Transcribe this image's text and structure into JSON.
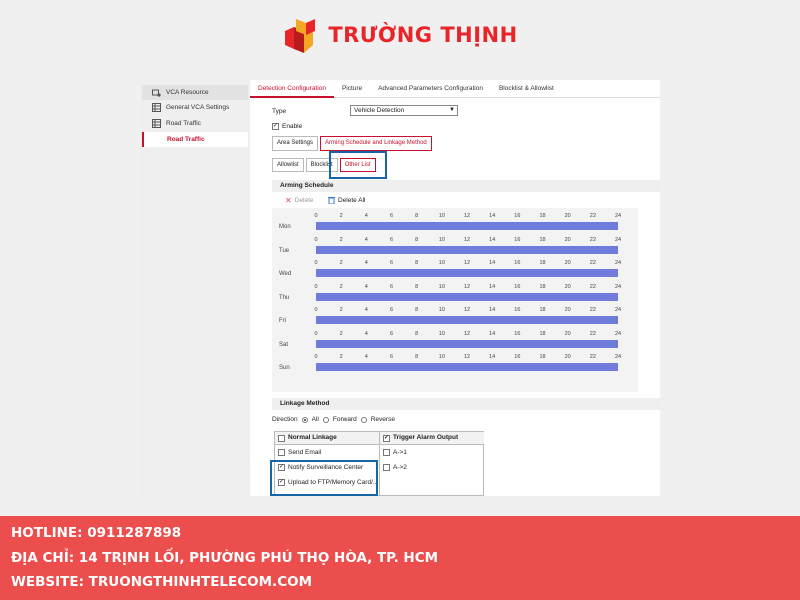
{
  "brand": {
    "name": "TRƯỜNG THỊNH"
  },
  "sidebar": {
    "items": [
      {
        "label": "VCA Resource",
        "icon": "camera-gear-icon"
      },
      {
        "label": "General VCA Settings",
        "icon": "grid-settings-icon"
      },
      {
        "label": "Road Traffic",
        "icon": "grid-settings-icon"
      },
      {
        "label": "Road Traffic",
        "icon": ""
      }
    ]
  },
  "tabs": [
    "Detection Configuration",
    "Picture",
    "Advanced Parameters Configuration",
    "Blocklist & Allowlist"
  ],
  "form": {
    "type_label": "Type",
    "type_value": "Vehicle Detection",
    "enable_label": "Enable"
  },
  "subtabs": [
    "Area Settings",
    "Arming Schedule and Linkage Method"
  ],
  "sched_tabs": [
    "Allowlist",
    "Blocklist",
    "Other List"
  ],
  "schedule": {
    "title": "Arming Schedule",
    "delete_label": "Delete",
    "delete_all_label": "Delete All",
    "hours": [
      "0",
      "2",
      "4",
      "6",
      "8",
      "10",
      "12",
      "14",
      "16",
      "18",
      "20",
      "22",
      "24"
    ],
    "days": [
      "Mon",
      "Tue",
      "Wed",
      "Thu",
      "Fri",
      "Sat",
      "Sun"
    ],
    "bar_color": "#6f7cdb"
  },
  "linkage": {
    "title": "Linkage Method",
    "direction_label": "Direction",
    "directions": [
      "All",
      "Forward",
      "Reverse"
    ],
    "selected_direction": "All",
    "normal_header": "Normal Linkage",
    "trigger_header": "Trigger Alarm Output",
    "normal_items": [
      {
        "label": "Send Email",
        "checked": false
      },
      {
        "label": "Notify Surveillance Center",
        "checked": true
      },
      {
        "label": "Upload to FTP/Memory Card/...",
        "checked": true
      }
    ],
    "trigger_items": [
      {
        "label": "A->1",
        "checked": false
      },
      {
        "label": "A->2",
        "checked": false
      }
    ]
  },
  "footer": {
    "hotline": "HOTLINE: 0911287898",
    "address": "ĐỊA CHỈ: 14 TRỊNH LỐI, PHƯỜNG PHÚ THỌ HÒA, TP. HCM",
    "website": "WEBSITE: TRUONGTHINHTELECOM.COM"
  },
  "colors": {
    "accent": "#c8102e",
    "footer_bg": "#ec4d4d",
    "highlight": "#1565a8"
  }
}
